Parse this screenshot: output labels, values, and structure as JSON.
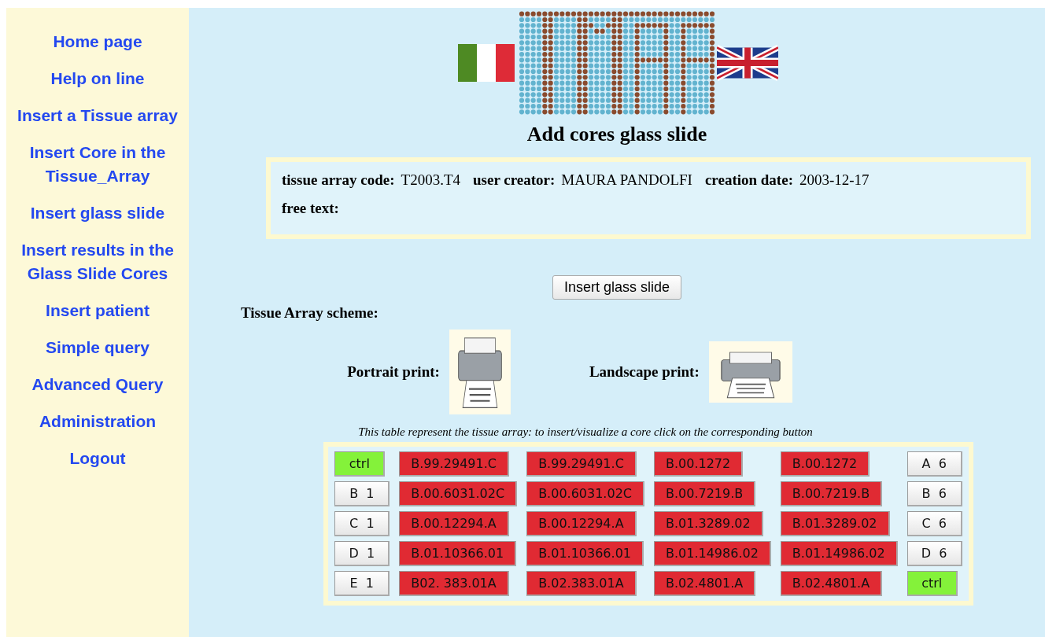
{
  "sidebar": {
    "items": [
      {
        "label": "Home page"
      },
      {
        "label": "Help on line"
      },
      {
        "label": "Insert a Tissue array"
      },
      {
        "label": "Insert Core in the Tissue_Array"
      },
      {
        "label": "Insert glass slide"
      },
      {
        "label": "Insert results in the Glass Slide Cores"
      },
      {
        "label": "Insert patient"
      },
      {
        "label": "Simple query"
      },
      {
        "label": "Advanced Query"
      },
      {
        "label": "Administration"
      },
      {
        "label": "Logout"
      }
    ]
  },
  "page_title": "Add cores glass slide",
  "info": {
    "fields": [
      {
        "label": "tissue array code:",
        "value": "T2003.T4"
      },
      {
        "label": "user creator:",
        "value": "MAURA PANDOLFI"
      },
      {
        "label": "creation date:",
        "value": "2003-12-17"
      }
    ],
    "free_text_label": "free text:"
  },
  "insert_button": "Insert glass slide",
  "scheme_label": "Tissue Array scheme:",
  "prints": [
    {
      "label": "Portrait print:",
      "kind": "portrait"
    },
    {
      "label": "Landscape print:",
      "kind": "landscape"
    }
  ],
  "caption": "This table represent the tissue array: to insert/visualize a core click on the corresponding button",
  "grid": [
    [
      {
        "text": "ctrl",
        "kind": "ctrl"
      },
      {
        "text": "B.99.29491.C",
        "kind": "core"
      },
      {
        "text": "B.99.29491.C",
        "kind": "core"
      },
      {
        "text": "B.00.1272",
        "kind": "core"
      },
      {
        "text": "B.00.1272",
        "kind": "core"
      },
      {
        "text": "A  6",
        "kind": "label"
      }
    ],
    [
      {
        "text": "B  1",
        "kind": "label"
      },
      {
        "text": "B.00.6031.02C",
        "kind": "core"
      },
      {
        "text": "B.00.6031.02C",
        "kind": "core"
      },
      {
        "text": "B.00.7219.B",
        "kind": "core"
      },
      {
        "text": "B.00.7219.B",
        "kind": "core"
      },
      {
        "text": "B  6",
        "kind": "label"
      }
    ],
    [
      {
        "text": "C  1",
        "kind": "label"
      },
      {
        "text": "B.00.12294.A",
        "kind": "core"
      },
      {
        "text": "B.00.12294.A",
        "kind": "core"
      },
      {
        "text": "B.01.3289.02",
        "kind": "core"
      },
      {
        "text": "B.01.3289.02",
        "kind": "core"
      },
      {
        "text": "C  6",
        "kind": "label"
      }
    ],
    [
      {
        "text": "D  1",
        "kind": "label"
      },
      {
        "text": "B.01.10366.01",
        "kind": "core"
      },
      {
        "text": "B.01.10366.01",
        "kind": "core"
      },
      {
        "text": "B.01.14986.02",
        "kind": "core"
      },
      {
        "text": "B.01.14986.02",
        "kind": "core"
      },
      {
        "text": "D  6",
        "kind": "label"
      }
    ],
    [
      {
        "text": "E  1",
        "kind": "label"
      },
      {
        "text": "B02. 383.01A",
        "kind": "core"
      },
      {
        "text": "B.02.383.01A",
        "kind": "core"
      },
      {
        "text": "B.02.4801.A",
        "kind": "core"
      },
      {
        "text": "B.02.4801.A",
        "kind": "core"
      },
      {
        "text": "ctrl",
        "kind": "ctrl"
      }
    ]
  ]
}
